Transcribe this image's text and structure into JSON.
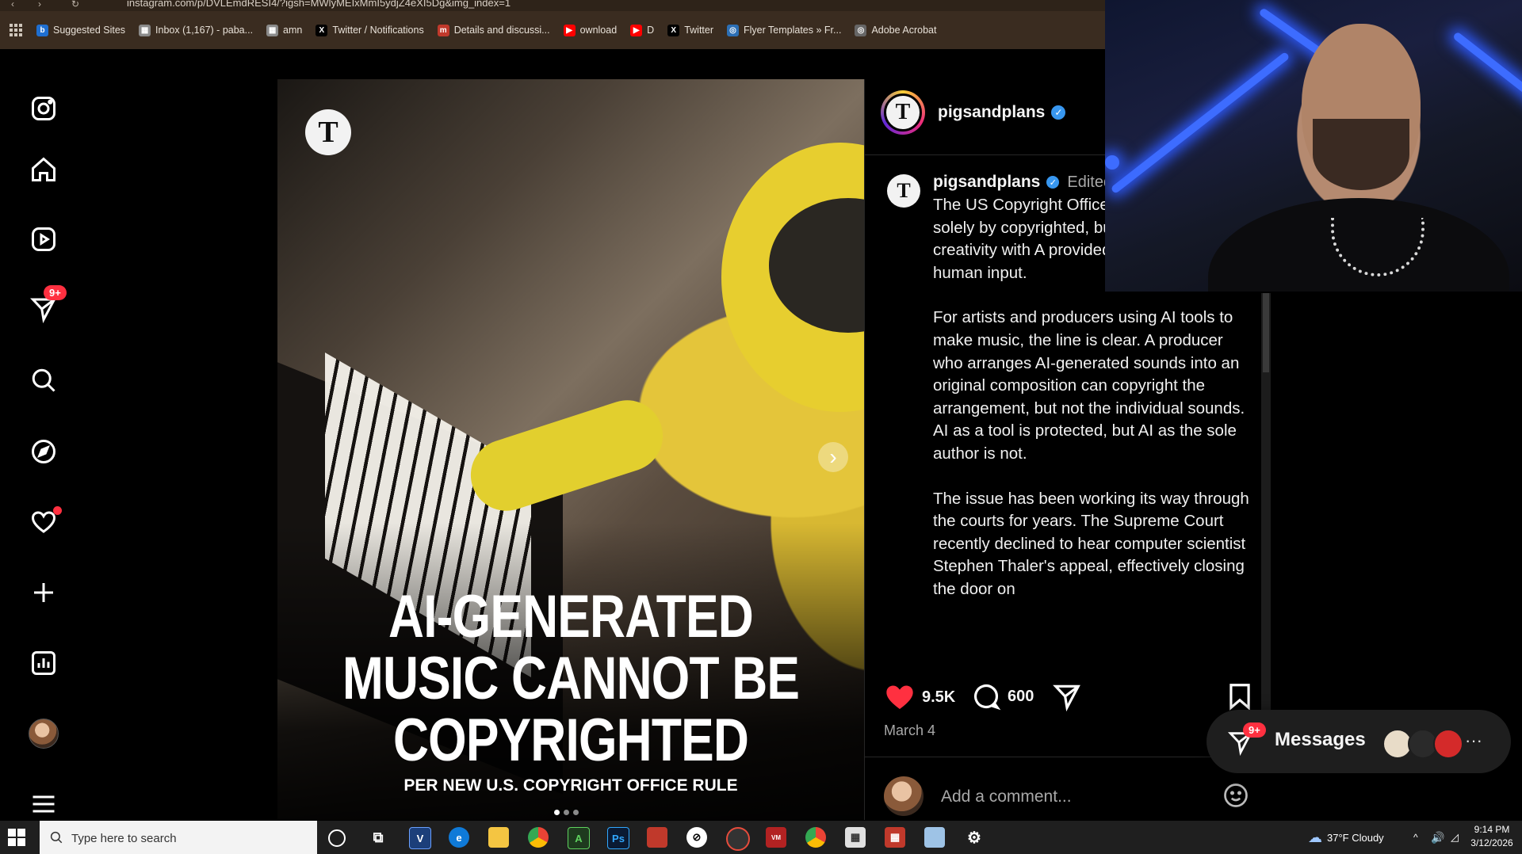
{
  "browser": {
    "url": "instagram.com/p/DVLEmdRESI4/?igsh=MWlyMEIxMmI5ydjZ4eXI5Dg&img_index=1",
    "bookmarks": [
      {
        "label": "Suggested Sites",
        "icon": "bing-icon",
        "color": "#1f6fd1",
        "glyph": "b"
      },
      {
        "label": "Inbox (1,167) - paba...",
        "icon": "calendar-icon",
        "color": "#8a8a8a",
        "glyph": "▦"
      },
      {
        "label": "amn",
        "icon": "calendar-icon",
        "color": "#8a8a8a",
        "glyph": "▦"
      },
      {
        "label": "Twitter / Notifications",
        "icon": "x-icon",
        "color": "#000000",
        "glyph": "X"
      },
      {
        "label": "Details and discussi...",
        "icon": "reddit-icon",
        "color": "#c0392b",
        "glyph": "m"
      },
      {
        "label": "ownload",
        "icon": "youtube-icon",
        "color": "#ff0000",
        "glyph": "▶"
      },
      {
        "label": "D",
        "icon": "youtube-icon",
        "color": "#ff0000",
        "glyph": "▶"
      },
      {
        "label": "Twitter",
        "icon": "x-icon",
        "color": "#000000",
        "glyph": "X"
      },
      {
        "label": "Flyer Templates » Fr...",
        "icon": "globe-icon",
        "color": "#2c6fb5",
        "glyph": "◎"
      },
      {
        "label": "Adobe Acrobat",
        "icon": "globe-icon",
        "color": "#666666",
        "glyph": "◎"
      }
    ]
  },
  "sidebar": {
    "notifications_badge": "9+"
  },
  "post": {
    "username": "pigsandplans",
    "media": {
      "headline_lines": [
        "AI-GENERATED",
        "MUSIC CANNOT BE",
        "COPYRIGHTED"
      ],
      "subheadline": "PER NEW U.S. COPYRIGHT OFFICE RULE",
      "logo_glyph": "T",
      "next_glyph": "›",
      "slide_index": 1,
      "slide_count": 3
    },
    "caption": {
      "username": "pigsandplans",
      "edited_label": "Edited",
      "paragraphs": [
        "The US Copyright Office works created solely by copyrighted, but works human creativity with A provided there is sufficient human input.",
        "For artists and producers using AI tools to make music, the line is clear. A producer who arranges AI-generated sounds into an original composition can copyright the arrangement, but not the individual sounds. AI as a tool is protected, but AI as the sole author is not.",
        "The issue has been working its way through the courts for years. The Supreme Court recently declined to hear computer scientist Stephen Thaler's appeal, effectively closing the door on"
      ]
    },
    "likes": "9.5K",
    "comments": "600",
    "date": "March 4",
    "comment_placeholder": "Add a comment..."
  },
  "messages": {
    "label": "Messages",
    "badge": "9+"
  },
  "taskbar": {
    "search_placeholder": "Type here to search",
    "weather": "37°F  Cloudy",
    "time": "9:14 PM",
    "date": "3/12/2026"
  },
  "colors": {
    "accent_like": "#ff3040",
    "verified_blue": "#3897f0",
    "badge_red": "#ff3040"
  }
}
